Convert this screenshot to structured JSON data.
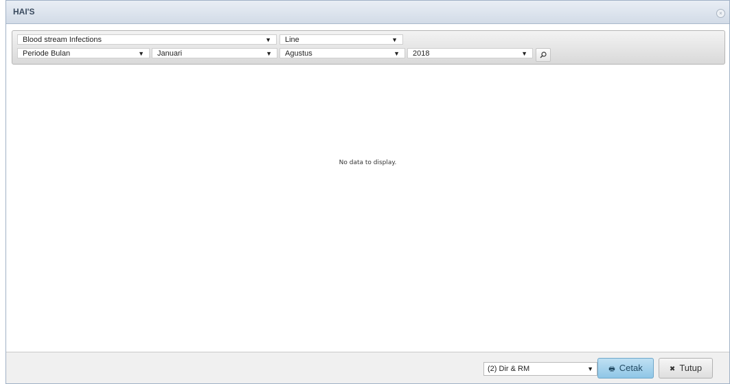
{
  "window": {
    "title": "HAI'S",
    "close_glyph": "×"
  },
  "filters": {
    "infection_type": "Blood stream Infections",
    "chart_type": "Line",
    "period_type": "Periode Bulan",
    "month_from": "Januari",
    "month_to": "Agustus",
    "year": "2018",
    "dropdown_glyph": "▼",
    "search_icon": "search-icon"
  },
  "content": {
    "empty_message": "No data to display."
  },
  "footer": {
    "print_option": "(2) Dir & RM",
    "print_button": "Cetak",
    "close_button": "Tutup",
    "print_icon": "printer-icon",
    "close_icon": "close-icon"
  }
}
